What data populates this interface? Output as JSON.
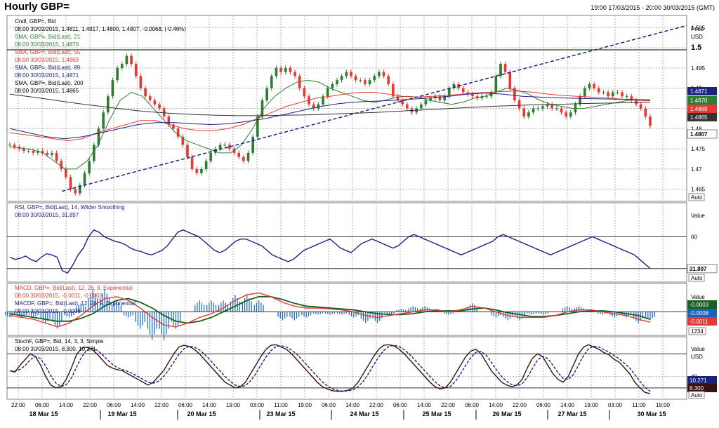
{
  "header": {
    "title": "Hourly GBP=",
    "range": "19:00 17/03/2015 - 20:00 30/03/2015 (GMT)"
  },
  "colors": {
    "candle_up": "#2e7d32",
    "candle_down": "#e53935",
    "sma21": "#2e7d32",
    "sma55": "#e53935",
    "sma89": "#1a237e",
    "sma200": "#333333",
    "trend": "#1a237e",
    "rsi": "#1a237e",
    "macd": "#e53935",
    "macdf": "#1a5e20",
    "hist": "#1565c0",
    "stoch_k": "#3a1010",
    "stoch_d": "#1a237e",
    "grid": "#b0b0b0"
  },
  "price_panel": {
    "legend": [
      "Cndl, GBP=, Bid",
      "08:00 30/03/2015, 1.4811, 1.4817, 1.4800, 1.4807, -0.0068, (-0.46%)",
      "SMA, GBP=, Bid(Last), 21",
      "08:00 30/03/2015, 1.4870",
      "SMA, GBP=, Bid(Last), 55",
      "08:00 30/03/2015, 1.4869",
      "SMA, GBP=, Bid(Last), 89",
      "08:00 30/03/2015, 1.4871",
      "SMA, GBP=, Bid(Last), 200",
      "08:00 30/03/2015, 1.4865"
    ],
    "axis_title": [
      "Price",
      "USD"
    ],
    "ticks": [
      "1.505",
      "1.5",
      "1.495",
      "1.49",
      "1.485",
      "1.48",
      "1.475",
      "1.47",
      "1.465"
    ],
    "tags": [
      "1.4871",
      "1.4870",
      "1.4869",
      "1.4865",
      "1.4807"
    ],
    "auto_label": "Auto"
  },
  "rsi_panel": {
    "legend": [
      "RSI, GBP=, Bid(Last), 14, Wilder Smoothing",
      "08:00 30/03/2015, 31.897"
    ],
    "axis_title": "Value",
    "ticks": [
      "60"
    ],
    "tag": "31.897",
    "auto_label": "Auto"
  },
  "macd_panel": {
    "legend": [
      "MACD, GBP=, Bid(Last), 12, 26, 9, Exponential",
      "08:00 30/03/2015, -0.0011, -0.0003",
      "MACDF, GBP=, Bid(Last), 12, 26, 9, Exponential",
      "08:00 30/03/2015, -0.0008"
    ],
    "axis_title": "Value",
    "tags": [
      "-0.0003",
      "-0.0008",
      "-0.0011"
    ],
    "counter_label": "1234"
  },
  "stoch_panel": {
    "legend": [
      "StochF, GBP=, Bid, 14, 3, 3, Simple",
      "08:00 30/03/2015, 8.300, 10.271"
    ],
    "axis_title": [
      "Value",
      "USD"
    ],
    "ticks": [
      "40"
    ],
    "tags": [
      "10.271",
      "8.300"
    ],
    "auto_label": "Auto"
  },
  "x_axis": {
    "times": [
      "22:00",
      "06:00",
      "14:00",
      "22:00",
      "06:00",
      "14:00",
      "22:00",
      "06:00",
      "14:00",
      "19:00",
      "03:00",
      "11:00",
      "19:00",
      "06:00",
      "14:00",
      "22:00",
      "06:00",
      "14:00",
      "22:00",
      "06:00",
      "14:00",
      "22:00",
      "06:00",
      "14:00",
      "19:00",
      "03:00",
      "11:00",
      "19:00"
    ],
    "dates": [
      "18 Mar 15",
      "19 Mar 15",
      "20 Mar 15",
      "23 Mar 15",
      "24 Mar 15",
      "25 Mar 15",
      "26 Mar 15",
      "27 Mar 15",
      "30 Mar 15"
    ]
  },
  "chart_data": {
    "type": "line",
    "price_ylim": [
      1.462,
      1.508
    ],
    "trendline": {
      "from": 1.4645,
      "to": 1.5055
    },
    "resistance": 1.4995,
    "close": [
      1.476,
      1.4755,
      1.475,
      1.4745,
      1.4745,
      1.474,
      1.4745,
      1.474,
      1.4735,
      1.474,
      1.472,
      1.47,
      1.468,
      1.465,
      1.464,
      1.466,
      1.469,
      1.472,
      1.476,
      1.48,
      1.484,
      1.488,
      1.492,
      1.495,
      1.496,
      1.498,
      1.496,
      1.493,
      1.49,
      1.488,
      1.487,
      1.486,
      1.485,
      1.483,
      1.481,
      1.48,
      1.478,
      1.476,
      1.473,
      1.47,
      1.469,
      1.47,
      1.472,
      1.474,
      1.475,
      1.476,
      1.476,
      1.475,
      1.474,
      1.473,
      1.472,
      1.474,
      1.478,
      1.483,
      1.487,
      1.49,
      1.493,
      1.495,
      1.494,
      1.495,
      1.494,
      1.493,
      1.49,
      1.488,
      1.486,
      1.485,
      1.486,
      1.488,
      1.49,
      1.491,
      1.492,
      1.493,
      1.494,
      1.493,
      1.492,
      1.492,
      1.491,
      1.492,
      1.493,
      1.494,
      1.493,
      1.491,
      1.488,
      1.487,
      1.486,
      1.485,
      1.484,
      1.485,
      1.486,
      1.487,
      1.4875,
      1.488,
      1.487,
      1.488,
      1.49,
      1.491,
      1.49,
      1.489,
      1.4885,
      1.488,
      1.4875,
      1.488,
      1.488,
      1.489,
      1.493,
      1.496,
      1.494,
      1.49,
      1.487,
      1.485,
      1.483,
      1.484,
      1.485,
      1.485,
      1.4855,
      1.486,
      1.485,
      1.485,
      1.484,
      1.483,
      1.484,
      1.486,
      1.488,
      1.49,
      1.491,
      1.49,
      1.489,
      1.489,
      1.488,
      1.489,
      1.489,
      1.488,
      1.488,
      1.487,
      1.486,
      1.485,
      1.483,
      1.4807
    ],
    "sma21": [
      1.4755,
      1.4752,
      1.4748,
      1.474,
      1.472,
      1.47,
      1.47,
      1.472,
      1.476,
      1.482,
      1.487,
      1.489,
      1.488,
      1.485,
      1.482,
      1.479,
      1.477,
      1.476,
      1.475,
      1.474,
      1.474,
      1.476,
      1.48,
      1.485,
      1.488,
      1.49,
      1.4915,
      1.492,
      1.4915,
      1.49,
      1.489,
      1.488,
      1.487,
      1.4865,
      1.487,
      1.4878,
      1.488,
      1.4878,
      1.487,
      1.4865,
      1.486,
      1.4865,
      1.4875,
      1.488,
      1.489,
      1.49,
      1.4895,
      1.4885,
      1.487,
      1.486,
      1.4855,
      1.485,
      1.485,
      1.4855,
      1.486,
      1.4865,
      1.487,
      1.4872,
      1.487
    ],
    "sma55": [
      1.479,
      1.4785,
      1.478,
      1.4775,
      1.477,
      1.4775,
      1.479,
      1.48,
      1.481,
      1.482,
      1.482,
      1.481,
      1.48,
      1.4795,
      1.4795,
      1.48,
      1.481,
      1.4825,
      1.484,
      1.4855,
      1.4865,
      1.4875,
      1.488,
      1.4885,
      1.489,
      1.489,
      1.4885,
      1.488,
      1.4878,
      1.488,
      1.4882,
      1.4885,
      1.4888,
      1.489,
      1.4892,
      1.4893,
      1.489,
      1.4885,
      1.4882,
      1.488,
      1.4878,
      1.4876,
      1.4873,
      1.487,
      1.4869
    ],
    "sma89": [
      1.48,
      1.479,
      1.478,
      1.4775,
      1.478,
      1.479,
      1.48,
      1.481,
      1.4815,
      1.4815,
      1.4812,
      1.481,
      1.4812,
      1.4818,
      1.4825,
      1.4835,
      1.4845,
      1.4855,
      1.4862,
      1.4866,
      1.4868,
      1.487,
      1.4873,
      1.4876,
      1.488,
      1.4885,
      1.4888,
      1.4885,
      1.488,
      1.4878,
      1.4876,
      1.4875,
      1.4874,
      1.4873,
      1.4872,
      1.4871
    ],
    "sma200": [
      1.4885,
      1.4878,
      1.487,
      1.4862,
      1.4855,
      1.4848,
      1.4842,
      1.4838,
      1.4835,
      1.4833,
      1.4832,
      1.4832,
      1.4833,
      1.4834,
      1.4836,
      1.4838,
      1.484,
      1.4843,
      1.4846,
      1.4849,
      1.4852,
      1.4855,
      1.4857,
      1.4859,
      1.486,
      1.4862,
      1.4863,
      1.4864,
      1.4865
    ],
    "rsi": [
      42,
      40,
      41,
      43,
      40,
      38,
      42,
      45,
      44,
      42,
      30,
      28,
      35,
      44,
      50,
      60,
      66,
      64,
      60,
      58,
      56,
      55,
      53,
      50,
      48,
      47,
      45,
      44,
      46,
      48,
      52,
      58,
      64,
      66,
      64,
      62,
      60,
      56,
      52,
      48,
      46,
      48,
      52,
      56,
      58,
      58,
      56,
      54,
      52,
      48,
      44,
      42,
      40,
      38,
      40,
      44,
      48,
      50,
      52,
      54,
      56,
      58,
      54,
      50,
      48,
      46,
      50,
      54,
      56,
      58,
      56,
      54,
      52,
      50,
      52,
      56,
      60,
      62,
      60,
      58,
      56,
      54,
      52,
      50,
      48,
      46,
      44,
      46,
      48,
      50,
      52,
      54,
      56,
      60,
      62,
      60,
      58,
      56,
      54,
      52,
      50,
      48,
      46,
      44,
      46,
      48,
      50,
      52,
      54,
      56,
      58,
      60,
      58,
      56,
      54,
      52,
      50,
      48,
      46,
      44,
      40,
      36,
      32
    ],
    "rsi_ylim": [
      20,
      90
    ],
    "macd": [
      -0.0004,
      -0.0006,
      -0.0008,
      -0.0012,
      -0.0016,
      -0.0012,
      -0.0004,
      0.0006,
      0.0014,
      0.0016,
      0.0012,
      0.0004,
      -0.0006,
      -0.0014,
      -0.0016,
      -0.0012,
      -0.0006,
      -0.0002,
      0.0004,
      0.0012,
      0.0018,
      0.002,
      0.0016,
      0.001,
      0.0006,
      0.0004,
      0.0004,
      0.0003,
      0.0002,
      0.0,
      -0.0004,
      -0.0006,
      -0.0004,
      -0.0002,
      0.0,
      0.0002,
      0.0002,
      0.0,
      0.0002,
      0.0006,
      0.0004,
      0.0,
      -0.0004,
      -0.0006,
      -0.0006,
      -0.0006,
      -0.0004,
      0.0,
      0.0002,
      0.0002,
      0.0,
      -0.0002,
      -0.0004,
      -0.0008,
      -0.0011
    ],
    "macdf": [
      -0.0002,
      -0.0004,
      -0.0006,
      -0.0008,
      -0.001,
      -0.001,
      -0.0007,
      -0.0002,
      0.0006,
      0.0012,
      0.0014,
      0.001,
      0.0004,
      -0.0004,
      -0.001,
      -0.0012,
      -0.001,
      -0.0006,
      0.0,
      0.0006,
      0.0012,
      0.0016,
      0.0016,
      0.0013,
      0.0009,
      0.0006,
      0.0005,
      0.0004,
      0.0003,
      0.0002,
      0.0,
      -0.0002,
      -0.0003,
      -0.0003,
      -0.0002,
      0.0,
      0.0001,
      0.0001,
      0.0001,
      0.0003,
      0.0004,
      0.0002,
      -0.0001,
      -0.0003,
      -0.0005,
      -0.0005,
      -0.0004,
      -0.0002,
      0.0,
      0.0001,
      0.0001,
      0.0,
      -0.0002,
      -0.0004,
      -0.0008
    ],
    "macd_ylim": [
      -0.0025,
      0.003
    ],
    "stoch": [
      50,
      48,
      60,
      70,
      80,
      75,
      60,
      40,
      25,
      20,
      22,
      35,
      55,
      78,
      90,
      92,
      88,
      80,
      70,
      60,
      55,
      52,
      50,
      45,
      40,
      35,
      30,
      25,
      30,
      40,
      50,
      65,
      80,
      92,
      95,
      93,
      88,
      80,
      70,
      60,
      50,
      40,
      30,
      25,
      20,
      22,
      30,
      45,
      60,
      75,
      88,
      95,
      96,
      92,
      88,
      80,
      70,
      60,
      50,
      40,
      30,
      22,
      18,
      15,
      14,
      14,
      16,
      20,
      30,
      45,
      60,
      75,
      88,
      95,
      96,
      94,
      88,
      80,
      70,
      60,
      50,
      40,
      30,
      22,
      18,
      20,
      30,
      45,
      60,
      75,
      85,
      88,
      80,
      65,
      50,
      40,
      30,
      25,
      22,
      25,
      35,
      55,
      72,
      80,
      75,
      60,
      45,
      35,
      30,
      40,
      60,
      80,
      92,
      96,
      92,
      88,
      82,
      78,
      70,
      65,
      55,
      45,
      30,
      20,
      12,
      10
    ],
    "stoch_ylim": [
      0,
      110
    ]
  }
}
